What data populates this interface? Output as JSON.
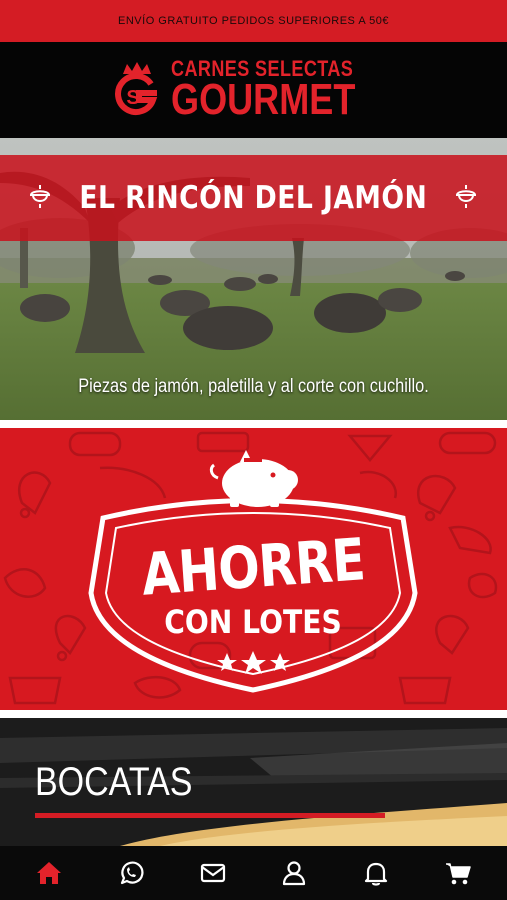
{
  "promo": {
    "text": "ENVÍO GRATUITO PEDIDOS SUPERIORES A 50€"
  },
  "brand": {
    "line1": "CARNES SELECTAS",
    "line2": "GOURMET",
    "emblem_letter": "S",
    "color": "#e3232b"
  },
  "banners": {
    "jamon": {
      "title": "EL RINCÓN DEL JAMÓN",
      "caption": "Piezas de jamón, paletilla y al corte con cuchillo."
    },
    "lotes": {
      "line1": "AHORRE",
      "line2": "CON LOTES"
    },
    "bocatas": {
      "title": "BOCATAS"
    }
  },
  "bottom_nav": {
    "items": [
      {
        "icon": "home-icon",
        "active": true
      },
      {
        "icon": "whatsapp-icon",
        "active": false
      },
      {
        "icon": "mail-icon",
        "active": false
      },
      {
        "icon": "user-icon",
        "active": false
      },
      {
        "icon": "bell-icon",
        "active": false
      },
      {
        "icon": "cart-icon",
        "active": false
      }
    ],
    "active_color": "#e3232b",
    "icon_color": "#ffffff"
  }
}
